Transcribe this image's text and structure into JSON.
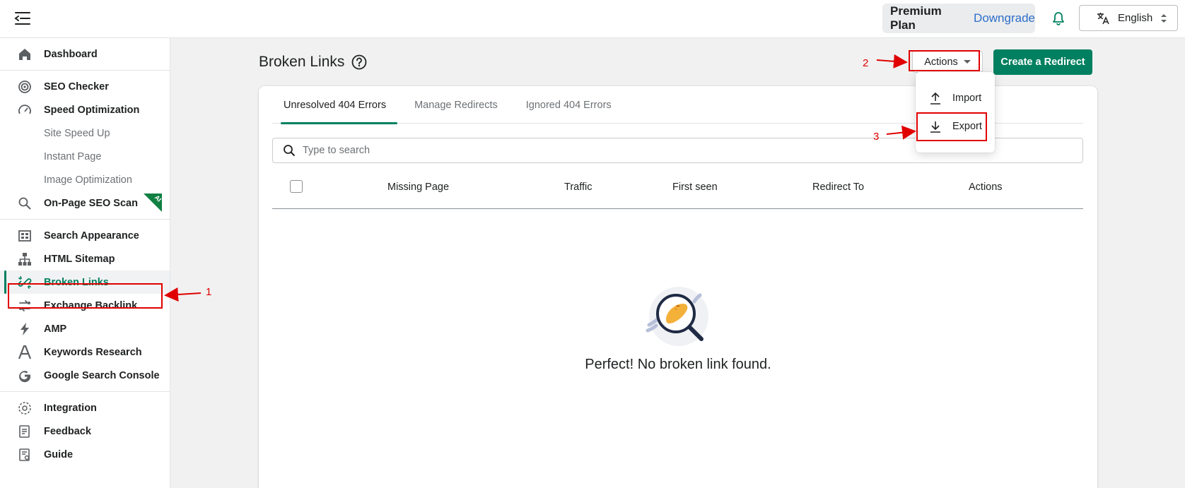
{
  "header": {
    "plan_name": "Premium Plan",
    "downgrade_label": "Downgrade",
    "language": "English"
  },
  "sidebar": {
    "groups": [
      [
        {
          "label": "Dashboard",
          "icon": "home-icon"
        }
      ],
      [
        {
          "label": "SEO Checker",
          "icon": "target-icon"
        },
        {
          "label": "Speed Optimization",
          "icon": "speedometer-icon"
        },
        {
          "label": "Site Speed Up",
          "sub": true
        },
        {
          "label": "Instant Page",
          "sub": true
        },
        {
          "label": "Image Optimization",
          "sub": true
        },
        {
          "label": "On-Page SEO Scan",
          "icon": "search-icon",
          "badge": "AI"
        }
      ],
      [
        {
          "label": "Search Appearance",
          "icon": "grid-icon"
        },
        {
          "label": "HTML Sitemap",
          "icon": "sitemap-icon"
        },
        {
          "label": "Broken Links",
          "icon": "broken-link-icon",
          "active": true
        },
        {
          "label": "Exchange Backlink",
          "icon": "exchange-icon"
        },
        {
          "label": "AMP",
          "icon": "lightning-icon"
        },
        {
          "label": "Keywords Research",
          "icon": "font-a-icon"
        },
        {
          "label": "Google Search Console",
          "icon": "google-icon"
        }
      ],
      [
        {
          "label": "Integration",
          "icon": "integration-icon"
        },
        {
          "label": "Feedback",
          "icon": "feedback-icon"
        },
        {
          "label": "Guide",
          "icon": "guide-icon"
        }
      ]
    ]
  },
  "main": {
    "title": "Broken Links",
    "actions_label": "Actions",
    "create_redirect_label": "Create a Redirect",
    "tabs": [
      "Unresolved 404 Errors",
      "Manage Redirects",
      "Ignored 404 Errors"
    ],
    "search_placeholder": "Type to search",
    "columns": [
      "Missing Page",
      "Traffic",
      "First seen",
      "Redirect To",
      "Actions"
    ],
    "empty_message": "Perfect! No broken link found."
  },
  "dropdown": {
    "items": [
      {
        "label": "Import",
        "icon": "upload-icon"
      },
      {
        "label": "Export",
        "icon": "download-icon"
      }
    ]
  },
  "annotations": [
    "1",
    "2",
    "3"
  ],
  "colors": {
    "accent": "#008060",
    "link": "#2c6ecb",
    "annotation": "#e00000"
  }
}
